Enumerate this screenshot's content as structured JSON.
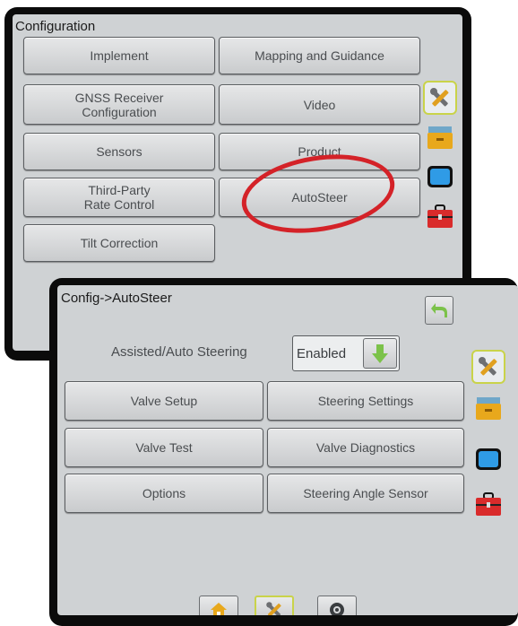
{
  "config_screen": {
    "title": "Configuration",
    "buttons": {
      "implement": "Implement",
      "mapping_guidance": "Mapping and Guidance",
      "gnss_receiver": "GNSS Receiver\nConfiguration",
      "video": "Video",
      "sensors": "Sensors",
      "product": "Product",
      "third_party": "Third-Party\nRate Control",
      "autosteer": "AutoSteer",
      "tilt_correction": "Tilt Correction"
    },
    "side_tabs": [
      "tools-icon",
      "storage-box-icon",
      "display-icon",
      "toolbox-icon"
    ]
  },
  "autosteer_screen": {
    "title": "Config->AutoSteer",
    "assisted_label": "Assisted/Auto Steering",
    "assisted_value": "Enabled",
    "buttons": {
      "valve_setup": "Valve Setup",
      "steering_settings": "Steering Settings",
      "valve_test": "Valve Test",
      "valve_diagnostics": "Valve Diagnostics",
      "options": "Options",
      "steering_angle_sensor": "Steering Angle Sensor"
    },
    "side_tabs": [
      "tools-icon",
      "storage-box-icon",
      "display-icon",
      "toolbox-icon"
    ],
    "bottom_tabs": [
      "home-icon",
      "tools-icon",
      "camera-icon"
    ]
  },
  "colors": {
    "highlight": "#d42228",
    "active_tab_border": "#c9d34a",
    "back_button": "#7cc24a",
    "bezel": "#0b0b0b"
  }
}
